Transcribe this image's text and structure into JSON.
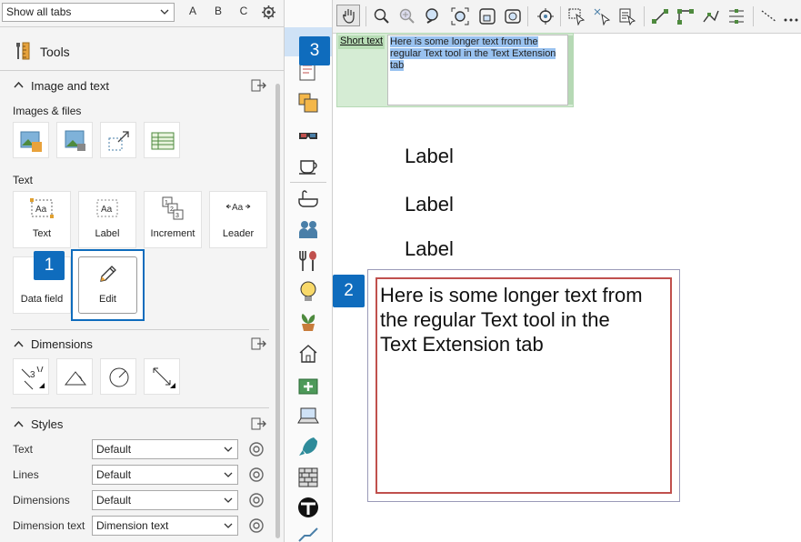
{
  "left_panel": {
    "filter": "Show all tabs",
    "sort_buttons": [
      "A",
      "B",
      "C"
    ],
    "title": "Tools",
    "image_text_section": {
      "heading": "Image and text",
      "images_sub": "Images & files",
      "text_sub": "Text",
      "text_tools": [
        "Text",
        "Label",
        "Increment",
        "Leader",
        "Data field",
        "Edit"
      ]
    },
    "dimensions_section": {
      "heading": "Dimensions"
    },
    "styles_section": {
      "heading": "Styles",
      "rows": [
        {
          "label": "Text",
          "value": "Default"
        },
        {
          "label": "Lines",
          "value": "Default"
        },
        {
          "label": "Dimensions",
          "value": "Default"
        },
        {
          "label": "Dimension text",
          "value": "Dimension text"
        }
      ]
    }
  },
  "callouts": [
    "1",
    "2",
    "3"
  ],
  "canvas": {
    "short_text_tag": "Short text",
    "selected_text": "Here is some longer text from the regular Text tool in the Text Extension tab",
    "labels": [
      "Label",
      "Label",
      "Label"
    ],
    "long_text_line1": "Here is some longer text from",
    "long_text_line2": "the regular Text tool in the",
    "long_text_line3": "Text Extension tab"
  },
  "colors": {
    "accent": "#0f6cbd",
    "selection": "#99c2f0",
    "green_panel": "#d5ecd4",
    "red_border": "#c0504d"
  }
}
